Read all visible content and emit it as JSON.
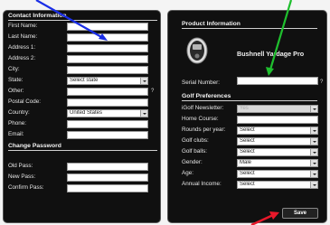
{
  "contact": {
    "heading": "Contact Information",
    "fields": [
      {
        "label": "First Name:",
        "value": ""
      },
      {
        "label": "Last Name:",
        "value": ""
      },
      {
        "label": "Address 1:",
        "value": ""
      },
      {
        "label": "Address 2:",
        "value": ""
      },
      {
        "label": "City:",
        "value": ""
      },
      {
        "label": "State:",
        "value": "Select state"
      },
      {
        "label": "Other:",
        "value": ""
      },
      {
        "label": "Postal Code:",
        "value": ""
      },
      {
        "label": "Country:",
        "value": "United States"
      },
      {
        "label": "Phone:",
        "value": ""
      },
      {
        "label": "Email:",
        "value": ""
      }
    ],
    "other_help": "?"
  },
  "password": {
    "heading": "Change Password",
    "fields": [
      {
        "label": "Old Pass:",
        "value": ""
      },
      {
        "label": "New Pass:",
        "value": ""
      },
      {
        "label": "Confirm Pass:",
        "value": ""
      }
    ]
  },
  "product": {
    "heading": "Product Information",
    "name": "Bushnell Yardage Pro",
    "serial_label": "Serial Number:",
    "serial_value": "",
    "serial_help": "?",
    "device_icon": "rangefinder-device-icon"
  },
  "golf": {
    "heading": "Golf Preferences",
    "fields": [
      {
        "label": "iGolf Newsletter:",
        "value": "Yes"
      },
      {
        "label": "Home Course:",
        "value": ""
      },
      {
        "label": "Rounds per year:",
        "value": "Select"
      },
      {
        "label": "Golf clubs:",
        "value": "Select"
      },
      {
        "label": "Golf balls:",
        "value": "Select"
      },
      {
        "label": "Gender:",
        "value": "Male"
      },
      {
        "label": "Age:",
        "value": "Select"
      },
      {
        "label": "Annual Income:",
        "value": "Select"
      }
    ]
  },
  "actions": {
    "save_label": "Save"
  },
  "colors": {
    "arrow_blue": "#1a2ee6",
    "arrow_green": "#1fbf2e",
    "arrow_red": "#e8182a",
    "panel": "#101010"
  }
}
